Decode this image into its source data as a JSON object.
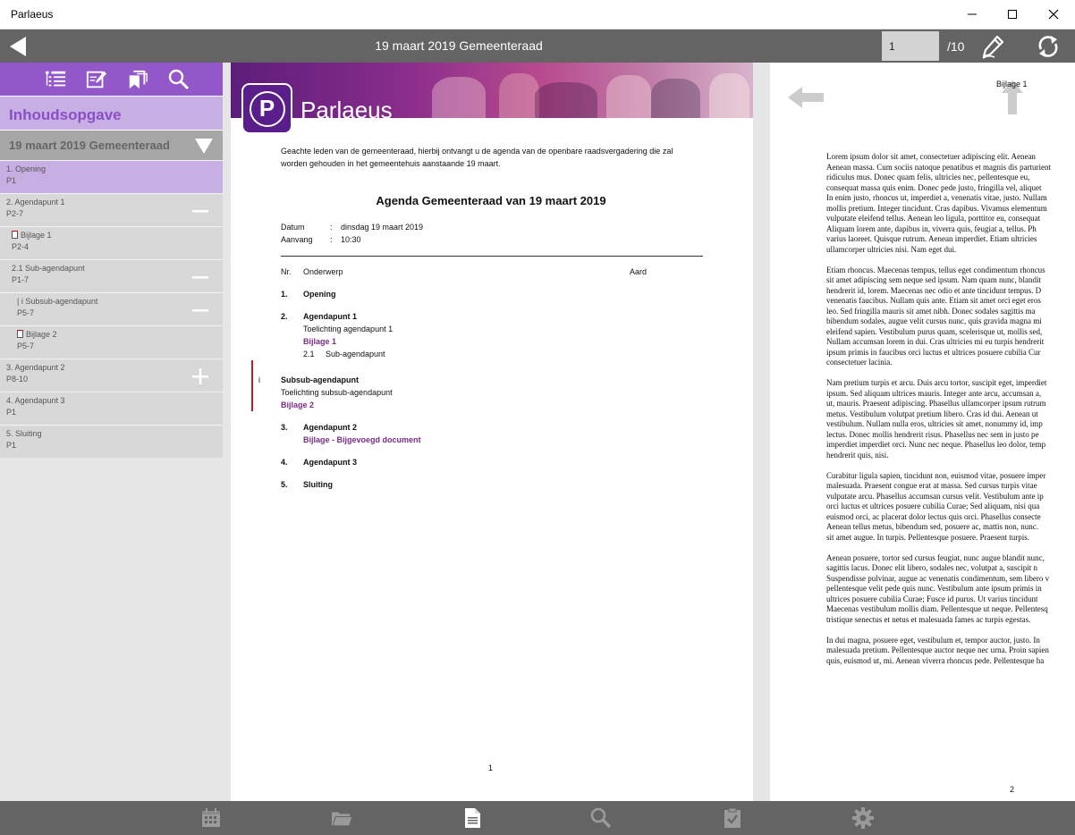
{
  "window": {
    "title": "Parlaeus"
  },
  "topbar": {
    "title": "19 maart 2019 Gemeenteraad",
    "page_value": "1",
    "page_total": "/10"
  },
  "sidebar": {
    "toc_title": "Inhoudsopgave",
    "meeting": "19 maart 2019 Gemeenteraad",
    "items": [
      {
        "label": "1. Opening",
        "pages": "P1"
      },
      {
        "label": "2. Agendapunt 1",
        "pages": "P2-7"
      },
      {
        "label": "Bijlage 1",
        "pages": "P2-4"
      },
      {
        "label": "2.1 Sub-agendapunt",
        "pages": "P1-7"
      },
      {
        "label": "| i Subsub-agendapunt",
        "pages": "P5-7"
      },
      {
        "label": "Bijlage 2",
        "pages": "P5-7"
      },
      {
        "label": "3. Agendapunt 2",
        "pages": "P8-10"
      },
      {
        "label": "4. Agendapunt 3",
        "pages": "P1"
      },
      {
        "label": "5. Sluiting",
        "pages": "P1"
      }
    ]
  },
  "page1": {
    "logo_letter": "P",
    "logo_text": "Parlaeus",
    "intro": "Geachte leden van de gemeenteraad, hierbij ontvangt u de agenda van de openbare raadsvergadering die zal worden gehouden in het gemeentehuis aanstaande 19 maart.",
    "agenda_title": "Agenda Gemeenteraad van 19 maart 2019",
    "datum_label": "Datum",
    "datum_value": "dinsdag 19 maart 2019",
    "aanvang_label": "Aanvang",
    "aanvang_value": "10:30",
    "colon": ":",
    "col_nr": "Nr.",
    "col_onderwerp": "Onderwerp",
    "col_aard": "Aard",
    "agenda": {
      "n1": "1.",
      "opening": "Opening",
      "n2": "2.",
      "agendapunt1": "Agendapunt 1",
      "toelichting1": "Toelichting agendapunt 1",
      "bijlage1": "Bijlage 1",
      "n21": "2.1",
      "sub": "Sub-agendapunt",
      "i": "i",
      "subsub": "Subsub-agendapunt",
      "toelichting_subsub": "Toelichting subsub-agendapunt",
      "bijlage2": "Bijlage 2",
      "n3": "3.",
      "agendapunt2": "Agendapunt 2",
      "bijlage_bijgevoegd": "Bijlage - Bijgevoegd document",
      "n4": "4.",
      "agendapunt3": "Agendapunt 3",
      "n5": "5.",
      "sluiting": "Sluiting"
    },
    "page_number": "1"
  },
  "page2": {
    "label": "Bijlage 1",
    "page_number": "2",
    "paragraphs": [
      [
        "Lorem ipsum dolor sit amet, consectetuer adipiscing elit. Aenean",
        "Aenean massa. Cum sociis natoque penatibus et magnis dis parturient",
        "ridiculus mus. Donec quam felis, ultricies nec, pellentesque eu,",
        "consequat massa quis enim. Donec pede justo, fringilla vel, aliquet",
        "In enim justo, rhoncus ut, imperdiet a, venenatis vitae, justo. Nullam",
        "mollis pretium. Integer tincidunt. Cras dapibus. Vivamus elementum",
        "vulputate eleifend tellus. Aenean leo ligula, porttitor eu, consequat",
        "Aliquam lorem ante, dapibus in, viverra quis, feugiat a, tellus. Ph",
        "varius laoreet. Quisque rutrum. Aenean imperdiet. Etiam ultricies",
        "ullamcorper ultricies nisi. Nam eget dui."
      ],
      [
        "Etiam rhoncus. Maecenas tempus, tellus eget condimentum rhoncus",
        "sit amet adipiscing sem neque sed ipsum. Nam quam nunc, blandit",
        "hendrerit id, lorem. Maecenas nec odio et ante tincidunt tempus. D",
        "venenatis faucibus. Nullam quis ante. Etiam sit amet orci eget eros",
        "leo. Sed fringilla mauris sit amet nibh. Donec sodales sagittis ma",
        "bibendum sodales, augue velit cursus nunc, quis gravida magna mi",
        "eleifend sapien. Vestibulum purus quam, scelerisque ut, mollis sed,",
        "Nullam accumsan lorem in dui. Cras ultricies mi eu turpis hendrerit",
        "ipsum primis in faucibus orci luctus et ultrices posuere cubilia Cur",
        "consectetuer lacinia."
      ],
      [
        "Nam pretium turpis et arcu. Duis arcu tortor, suscipit eget, imperdiet",
        "ipsum. Sed aliquam ultrices mauris. Integer ante arcu, accumsan a,",
        "ut, mauris. Praesent adipiscing. Phasellus ullamcorper ipsum rutrum",
        "metus. Vestibulum volutpat pretium libero. Cras id dui. Aenean ut",
        "vestibulum. Nullam nulla eros, ultricies sit amet, nonummy id, imp",
        "lectus. Donec mollis hendrerit risus. Phasellus nec sem in justo pe",
        "imperdiet imperdiet orci. Nunc nec neque. Phasellus leo dolor, temp",
        "hendrerit quis, nisi."
      ],
      [
        "Curabitur ligula sapien, tincidunt non, euismod vitae, posuere imper",
        "malesuada. Praesent congue erat at massa. Sed cursus turpis vitae",
        "vulputate arcu. Phasellus accumsan cursus velit. Vestibulum ante ip",
        "orci luctus et ultrices posuere cubilia Curae; Sed aliquam, nisi qua",
        "euismod orci, ac placerat dolor lectus quis orci. Phasellus consecte",
        "Aenean tellus metus, bibendum sed, posuere ac, mattis non, nunc.",
        "sit amet augue. In turpis. Pellentesque posuere. Praesent turpis."
      ],
      [
        "Aenean posuere, tortor sed cursus feugiat, nunc augue blandit nunc,",
        "sagittis lacus. Donec elit libero, sodales nec, volutpat a, suscipit n",
        "Suspendisse pulvinar, augue ac venenatis condimentum, sem libero v",
        "pellentesque velit pede quis nunc. Vestibulum ante ipsum primis in",
        "ultrices posuere cubilia Curae; Fusce id purus. Ut varius tincidunt",
        "Maecenas vestibulum mollis diam. Pellentesque ut neque. Pellentesq",
        "tristique senectus et netus et malesuada fames ac turpis egestas."
      ],
      [
        "In dui magna, posuere eget, vestibulum et, tempor auctor, justo. In",
        "malesuada pretium. Pellentesque auctor neque nec urna. Proin sapien",
        "quis, euismod ut, mi. Aenean viverra rhoncus pede. Pellentesque ha"
      ]
    ]
  },
  "colors": {
    "purple": "#9257c8",
    "purple_light": "#c8afe3",
    "bar_gray": "#646464",
    "link_purple": "#7a2d86",
    "red_marker": "#d4141e"
  }
}
